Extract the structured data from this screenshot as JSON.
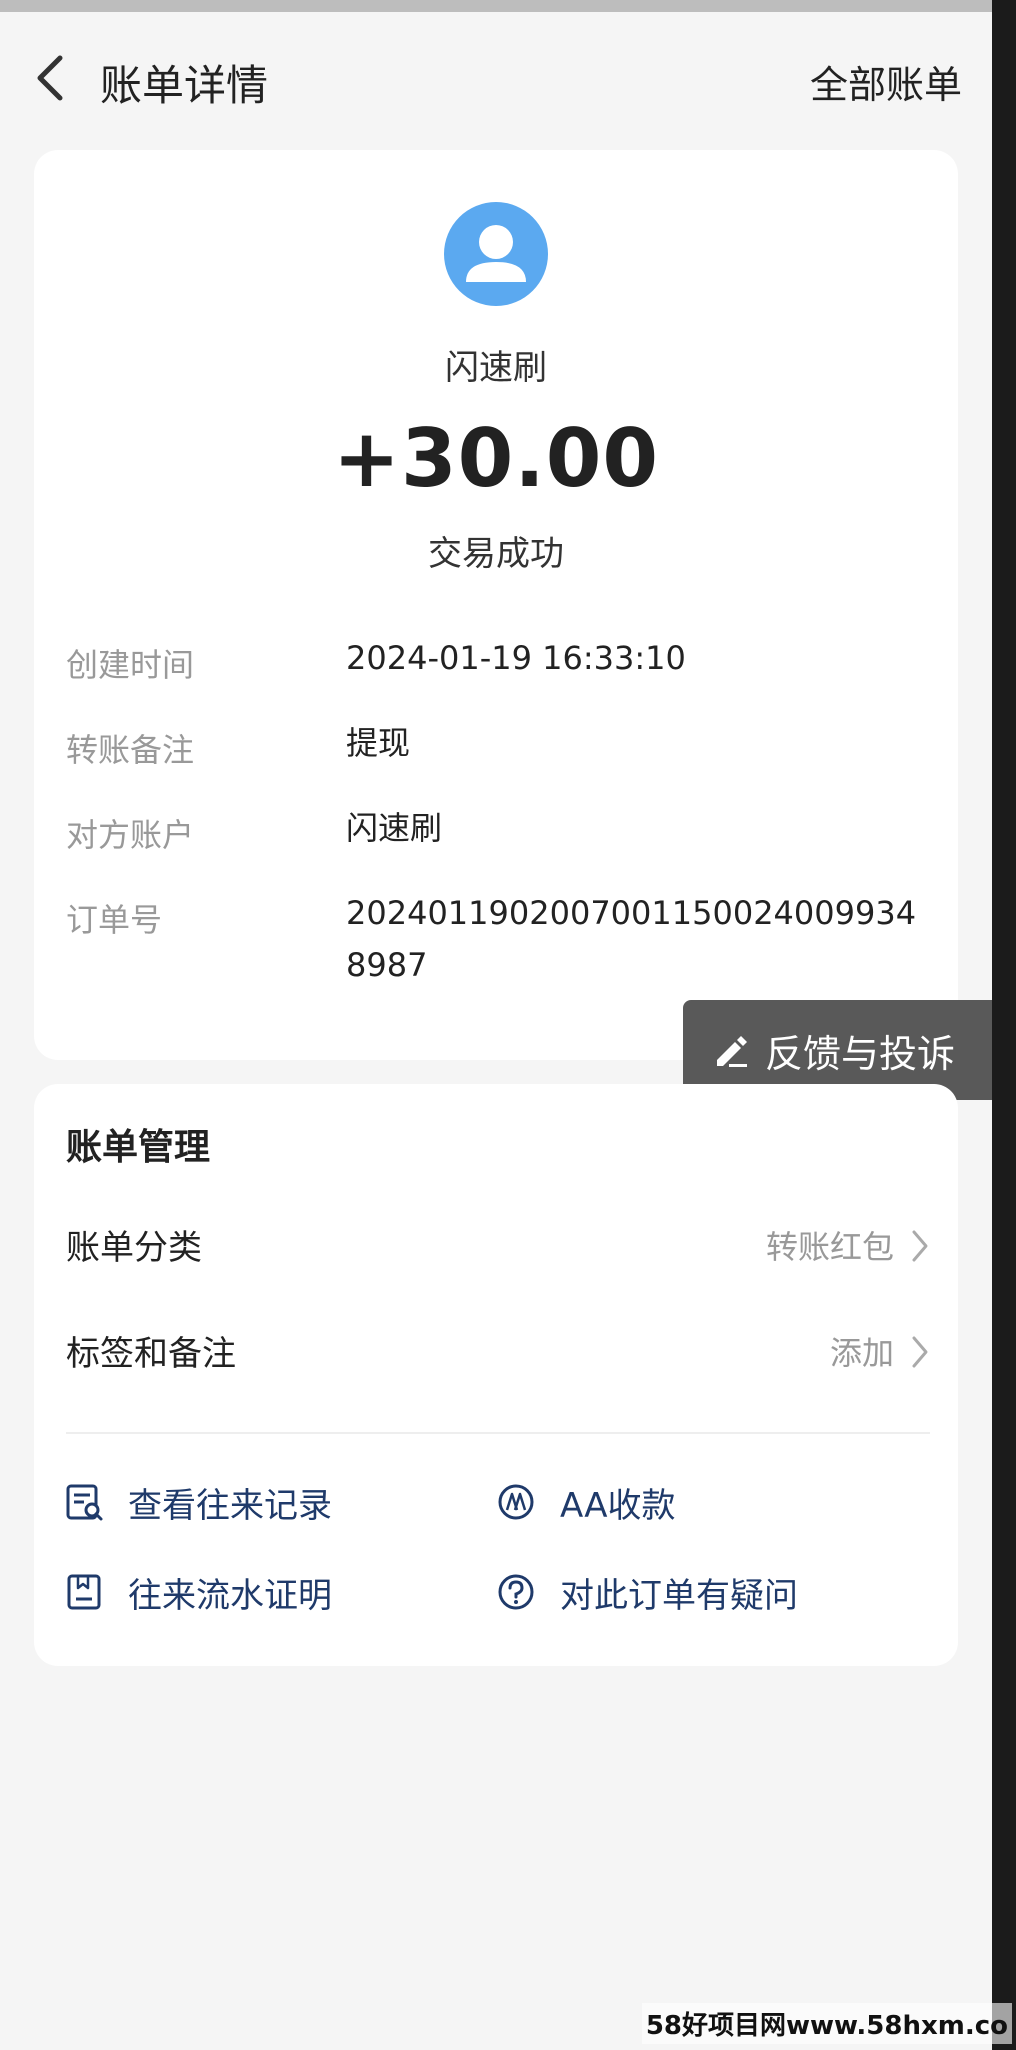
{
  "header": {
    "title": "账单详情",
    "right_link": "全部账单"
  },
  "transaction": {
    "payee": "闪速刷",
    "amount": "+30.00",
    "status": "交易成功"
  },
  "details": [
    {
      "label": "创建时间",
      "value": "2024-01-19 16:33:10"
    },
    {
      "label": "转账备注",
      "value": "提现"
    },
    {
      "label": "对方账户",
      "value": "闪速刷"
    },
    {
      "label": "订单号",
      "value": "20240119020070011500240099348987"
    }
  ],
  "feedback": {
    "label": "反馈与投诉"
  },
  "management": {
    "title": "账单管理",
    "rows": [
      {
        "label": "账单分类",
        "value": "转账红包"
      },
      {
        "label": "标签和备注",
        "value": "添加"
      }
    ]
  },
  "actions": [
    {
      "label": "查看往来记录",
      "icon": "record-search-icon"
    },
    {
      "label": "AA收款",
      "icon": "aa-icon"
    },
    {
      "label": "往来流水证明",
      "icon": "document-icon"
    },
    {
      "label": "对此订单有疑问",
      "icon": "question-icon"
    }
  ],
  "watermark": "58好项目网www.58hxm.co",
  "colors": {
    "avatar": "#5ba9f0",
    "action_text": "#1f3a6a",
    "muted": "#999999",
    "feedback_bg": "#595959"
  }
}
